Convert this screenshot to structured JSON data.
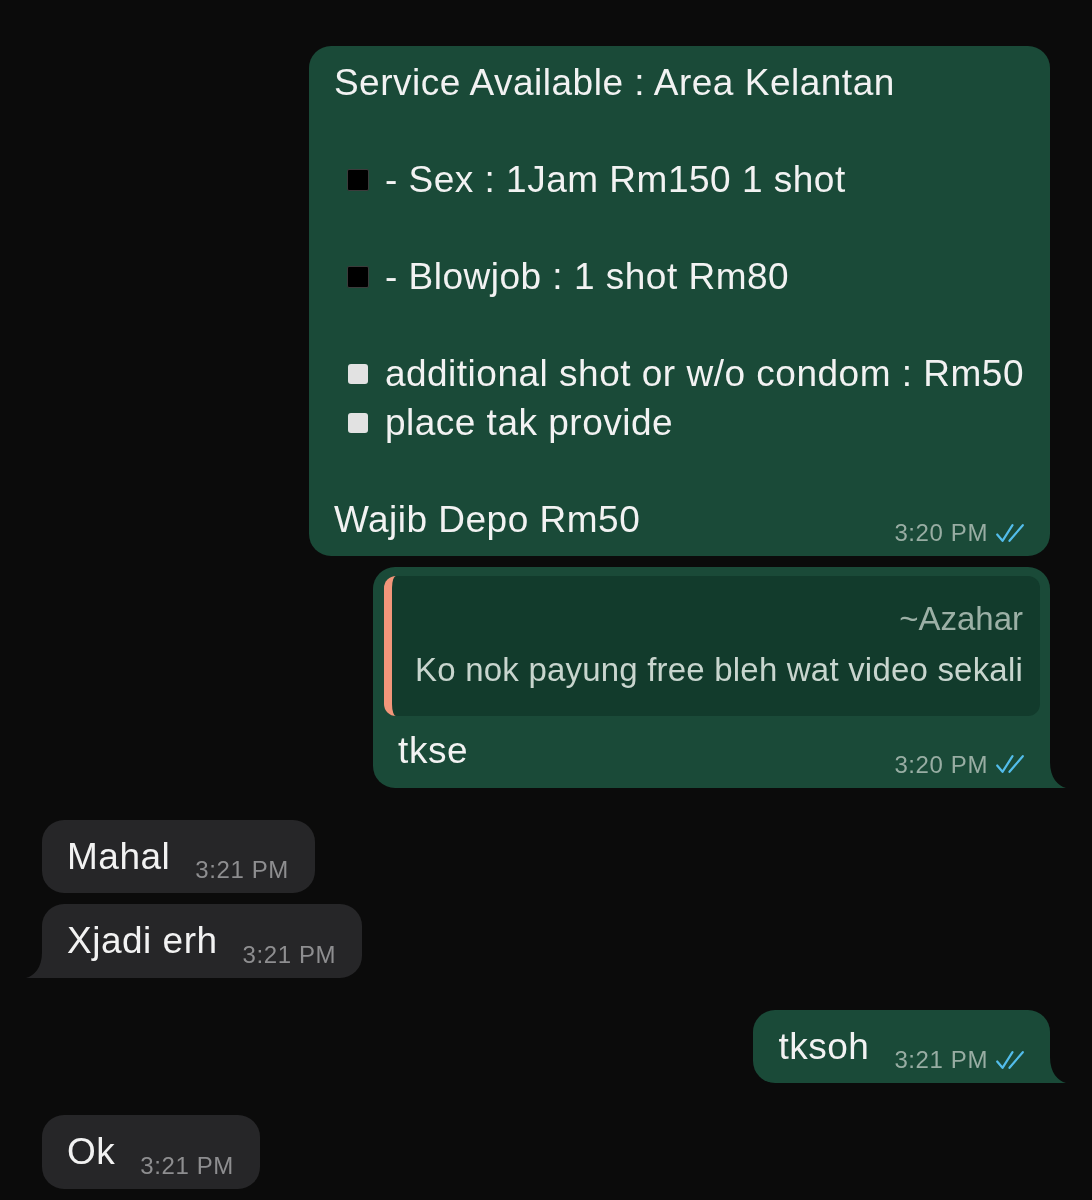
{
  "chat": {
    "messages": [
      {
        "kind": "outgoing",
        "tail": false,
        "read": true,
        "paragraphs": [
          [
            {
              "kind": "text",
              "text": "Service Available : Area Kelantan"
            }
          ],
          [
            {
              "kind": "black-square",
              "text": "- Sex : 1Jam Rm150 1 shot"
            }
          ],
          [
            {
              "kind": "black-square",
              "text": "- Blowjob : 1 shot Rm80"
            }
          ],
          [
            {
              "kind": "white-square",
              "text": "additional shot or w/o condom : Rm50"
            },
            {
              "kind": "white-square",
              "text": "place tak provide"
            }
          ],
          [
            {
              "kind": "text",
              "text": "Wajib Depo Rm50"
            }
          ]
        ],
        "time": "3:20 PM"
      },
      {
        "kind": "outgoing",
        "tail": true,
        "read": true,
        "quote": {
          "author": "~Azahar",
          "text": "Ko nok payung free bleh wat video sekali"
        },
        "paragraphs": [
          [
            {
              "kind": "text",
              "text": "tkse"
            }
          ]
        ],
        "time": "3:20 PM"
      },
      {
        "kind": "incoming",
        "tail": false,
        "paragraphs": [
          [
            {
              "kind": "text",
              "text": "Mahal"
            }
          ]
        ],
        "time": "3:21 PM"
      },
      {
        "kind": "incoming",
        "tail": true,
        "paragraphs": [
          [
            {
              "kind": "text",
              "text": "Xjadi erh"
            }
          ]
        ],
        "time": "3:21 PM"
      },
      {
        "kind": "outgoing",
        "tail": true,
        "read": true,
        "paragraphs": [
          [
            {
              "kind": "text",
              "text": "tksoh"
            }
          ]
        ],
        "time": "3:21 PM"
      },
      {
        "kind": "incoming",
        "tail": false,
        "paragraphs": [
          [
            {
              "kind": "text",
              "text": "Ok"
            }
          ]
        ],
        "time": "3:21 PM"
      }
    ]
  }
}
